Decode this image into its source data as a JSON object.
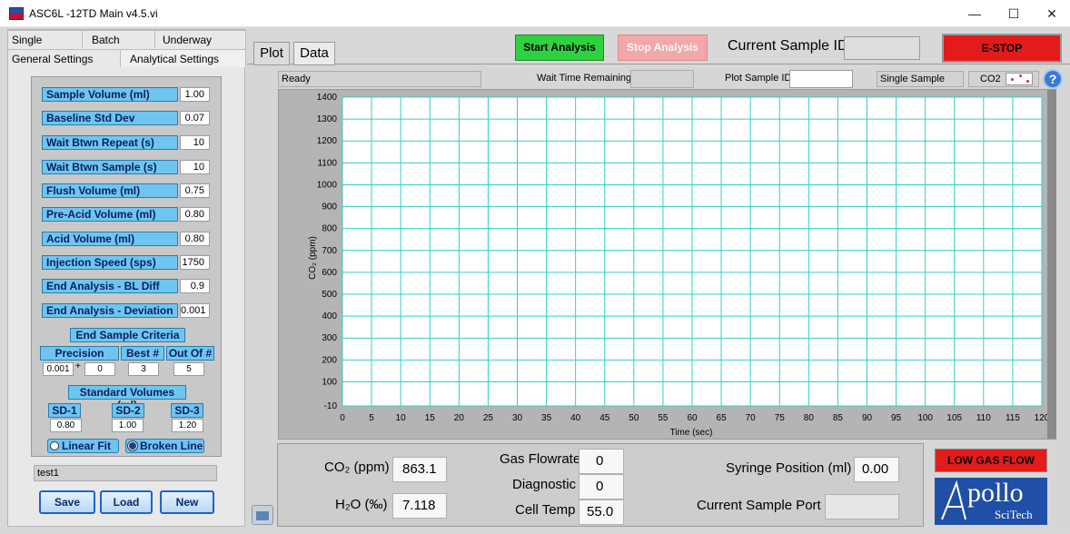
{
  "window": {
    "title": "ASC6L -12TD Main v4.5.vi",
    "minimize": "—",
    "maximize": "☐",
    "close": "✕"
  },
  "left_tabs": {
    "row1": [
      "Single",
      "Batch",
      "Underway"
    ],
    "row2": [
      "General Settings",
      "Analytical Settings"
    ]
  },
  "params": [
    {
      "label": "Sample Volume (ml)",
      "value": "1.00"
    },
    {
      "label": "Baseline Std Dev",
      "value": "0.07"
    },
    {
      "label": "Wait Btwn Repeat (s)",
      "value": "10"
    },
    {
      "label": "Wait Btwn Sample (s)",
      "value": "10"
    },
    {
      "label": "Flush Volume (ml)",
      "value": "0.75"
    },
    {
      "label": "Pre-Acid Volume (ml)",
      "value": "0.80"
    },
    {
      "label": "Acid Volume (ml)",
      "value": "0.80"
    },
    {
      "label": "Injection Speed (sps)",
      "value": "1750"
    },
    {
      "label": "End Analysis - BL Diff",
      "value": "0.9"
    },
    {
      "label": "End Analysis - Deviation",
      "value": "0.001"
    }
  ],
  "end_criteria": {
    "title": "End Sample Criteria",
    "precision_label": "Precision",
    "best_label": "Best #",
    "outof_label": "Out Of #",
    "precision_value": "0.001",
    "precision_extra": "0",
    "plusminus": "+",
    "best_value": "3",
    "outof_value": "5"
  },
  "std_volumes": {
    "title": "Standard Volumes (ml)",
    "items": [
      {
        "label": "SD-1",
        "value": "0.80"
      },
      {
        "label": "SD-2",
        "value": "1.00"
      },
      {
        "label": "SD-3",
        "value": "1.20"
      }
    ]
  },
  "fit": {
    "linear_label": "Linear Fit",
    "broken_label": "Broken Line",
    "selected": "Broken Line"
  },
  "file_name": "test1",
  "buttons": {
    "save": "Save",
    "load": "Load",
    "new": "New"
  },
  "main_tabs": [
    "Plot",
    "Data"
  ],
  "controls": {
    "start": "Start Analysis",
    "stop": "Stop Analysis",
    "current_sample_id_label": "Current Sample ID",
    "estop": "E-STOP"
  },
  "status": {
    "message": "Ready",
    "wait_label": "Wait Time Remaining",
    "plot_sample_label": "Plot Sample ID",
    "mode": "Single Sample",
    "gas": "CO2",
    "help": "?"
  },
  "chart_data": {
    "type": "line",
    "xlabel": "Time (sec)",
    "ylabel": "CO₂ (ppm)",
    "xlim": [
      0,
      120
    ],
    "ylim": [
      -10,
      1400
    ],
    "x_ticks": [
      0,
      5,
      10,
      15,
      20,
      25,
      30,
      35,
      40,
      45,
      50,
      55,
      60,
      65,
      70,
      75,
      80,
      85,
      90,
      95,
      100,
      105,
      110,
      115,
      120
    ],
    "y_ticks": [
      -10,
      100,
      200,
      300,
      400,
      500,
      600,
      700,
      800,
      900,
      1000,
      1100,
      1200,
      1300,
      1400
    ],
    "grid": true,
    "grid_color": "#2fd1c4",
    "series": []
  },
  "readouts": {
    "co2_label": "CO₂ (ppm)",
    "co2_value": "863.1",
    "h2o_label": "H₂O (‰)",
    "h2o_value": "7.118",
    "gas_flow_label": "Gas Flowrate",
    "gas_flow_value": "0",
    "diagnostic_label": "Diagnostic",
    "diagnostic_value": "0",
    "cell_temp_label": "Cell Temp",
    "cell_temp_value": "55.0",
    "syringe_label": "Syringe Position (ml)",
    "syringe_value": "0.00",
    "port_label": "Current Sample Port"
  },
  "alarm": "LOW GAS FLOW",
  "logo": {
    "main": "pollo",
    "sub": "SciTech"
  },
  "colors": {
    "accent": "#6ec6f0",
    "start": "#2ed13e",
    "estop": "#e31b1b",
    "grid": "#2fd1c4"
  }
}
